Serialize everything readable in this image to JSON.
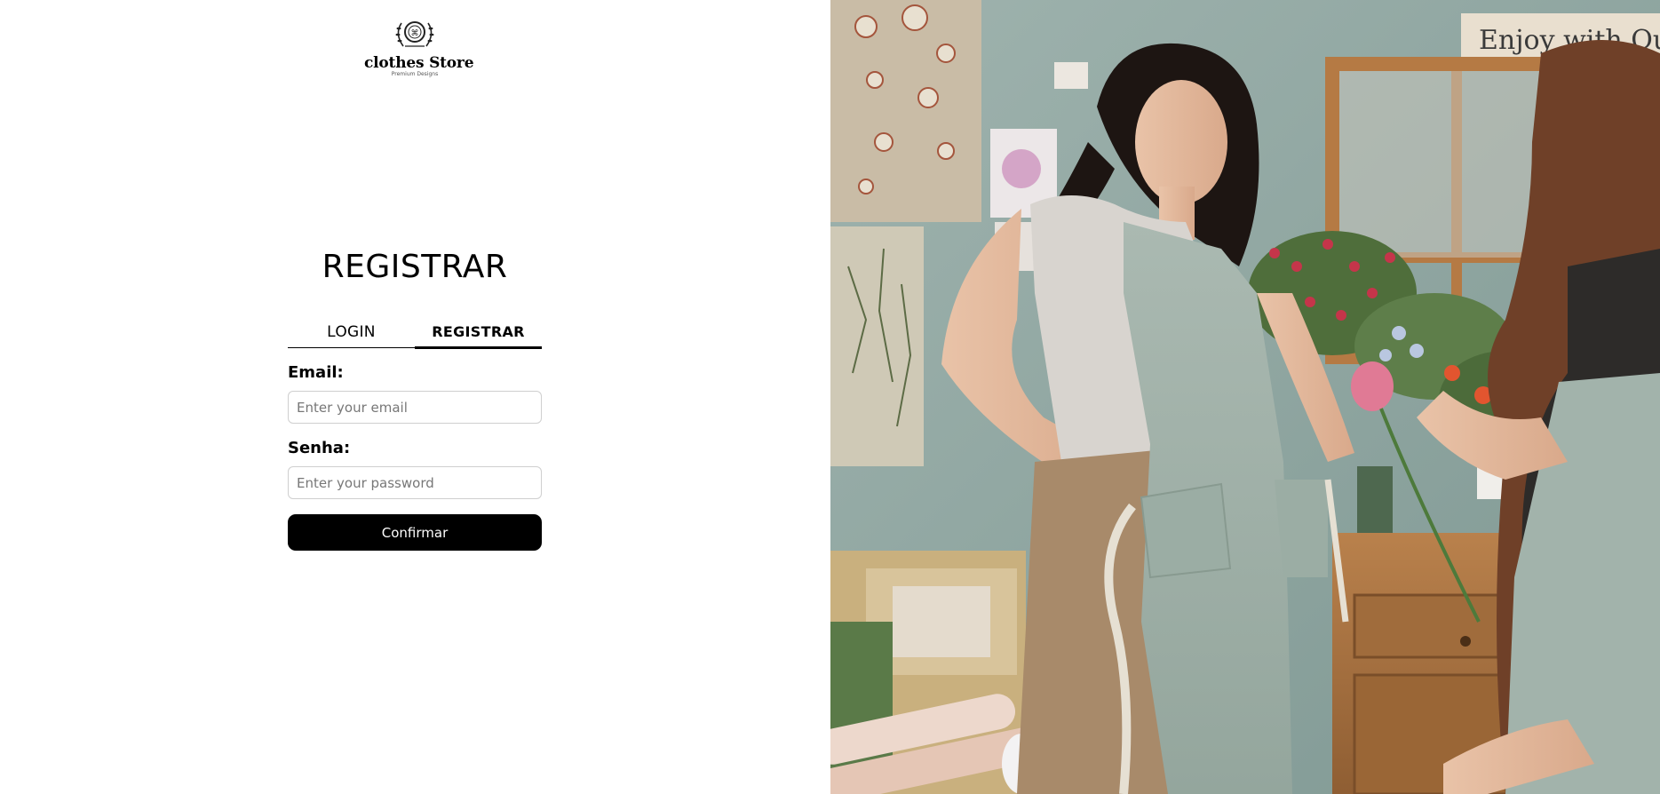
{
  "brand": {
    "name": "clothes Store",
    "tagline": "Premium Designs"
  },
  "form": {
    "heading": "REGISTRAR",
    "tabs": [
      {
        "label": "LOGIN",
        "active": false
      },
      {
        "label": "REGISTRAR",
        "active": true
      }
    ],
    "email_label": "Email:",
    "email_placeholder": "Enter your email",
    "password_label": "Senha:",
    "password_placeholder": "Enter your password",
    "submit_label": "Confirmar"
  },
  "photo": {
    "sign_text": "Enjoy with Our"
  },
  "colors": {
    "button_bg": "#000000",
    "button_text": "#ffffff",
    "wall": "#8fa7a3",
    "apron": "#a4b5ac"
  }
}
